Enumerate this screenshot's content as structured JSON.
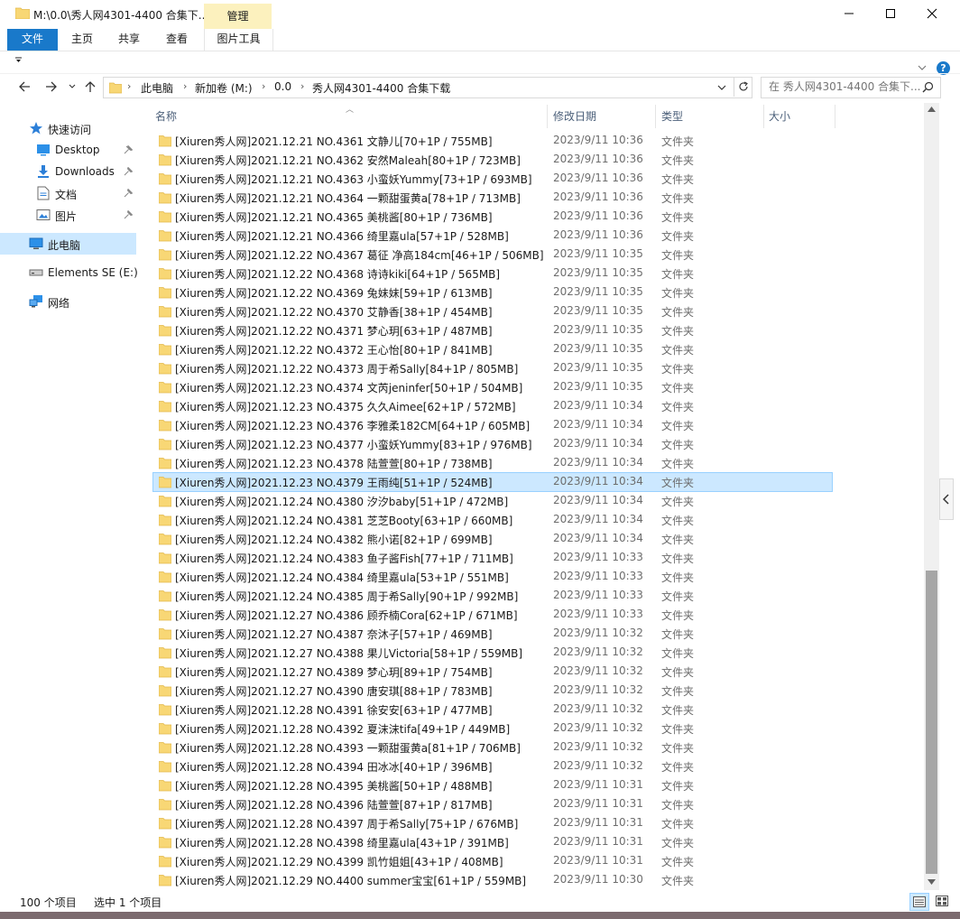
{
  "window": {
    "title": "M:\\0.0\\秀人网4301-4400 合集下...",
    "manage_tab": "管理"
  },
  "ribbon": {
    "tabs": [
      "文件",
      "主页",
      "共享",
      "查看",
      "图片工具"
    ]
  },
  "address": {
    "crumbs": [
      "此电脑",
      "新加卷 (M:)",
      "0.0",
      "秀人网4301-4400 合集下载"
    ]
  },
  "search": {
    "placeholder": "在 秀人网4301-4400 合集下..."
  },
  "nav": {
    "quick_access": "快速访问",
    "items": [
      {
        "label": "Desktop",
        "icon": "desktop-icon",
        "pinned": true
      },
      {
        "label": "Downloads",
        "icon": "downloads-icon",
        "pinned": true
      },
      {
        "label": "文档",
        "icon": "documents-icon",
        "pinned": true
      },
      {
        "label": "图片",
        "icon": "pictures-icon",
        "pinned": true
      }
    ],
    "this_pc": "此电脑",
    "drive": "Elements SE (E:)",
    "network": "网络"
  },
  "columns": {
    "name": "名称",
    "date": "修改日期",
    "type": "类型",
    "size": "大小"
  },
  "files": [
    {
      "name": "[Xiuren秀人网]2021.12.21 NO.4361 文静儿[70+1P / 755MB]",
      "date": "2023/9/11 10:36",
      "type": "文件夹"
    },
    {
      "name": "[Xiuren秀人网]2021.12.21 NO.4362 安然Maleah[80+1P / 723MB]",
      "date": "2023/9/11 10:36",
      "type": "文件夹"
    },
    {
      "name": "[Xiuren秀人网]2021.12.21 NO.4363 小蛮妖Yummy[73+1P / 693MB]",
      "date": "2023/9/11 10:36",
      "type": "文件夹"
    },
    {
      "name": "[Xiuren秀人网]2021.12.21 NO.4364 一颗甜蛋黄a[78+1P / 713MB]",
      "date": "2023/9/11 10:36",
      "type": "文件夹"
    },
    {
      "name": "[Xiuren秀人网]2021.12.21 NO.4365 美桃酱[80+1P / 736MB]",
      "date": "2023/9/11 10:36",
      "type": "文件夹"
    },
    {
      "name": "[Xiuren秀人网]2021.12.21 NO.4366 绮里嘉ula[57+1P / 528MB]",
      "date": "2023/9/11 10:36",
      "type": "文件夹"
    },
    {
      "name": "[Xiuren秀人网]2021.12.22 NO.4367 葛征 净高184cm[46+1P / 506MB]",
      "date": "2023/9/11 10:35",
      "type": "文件夹"
    },
    {
      "name": "[Xiuren秀人网]2021.12.22 NO.4368 诗诗kiki[64+1P / 565MB]",
      "date": "2023/9/11 10:35",
      "type": "文件夹"
    },
    {
      "name": "[Xiuren秀人网]2021.12.22 NO.4369 兔妹妹[59+1P / 613MB]",
      "date": "2023/9/11 10:35",
      "type": "文件夹"
    },
    {
      "name": "[Xiuren秀人网]2021.12.22 NO.4370 艾静香[38+1P / 454MB]",
      "date": "2023/9/11 10:35",
      "type": "文件夹"
    },
    {
      "name": "[Xiuren秀人网]2021.12.22 NO.4371 梦心玥[63+1P / 487MB]",
      "date": "2023/9/11 10:35",
      "type": "文件夹"
    },
    {
      "name": "[Xiuren秀人网]2021.12.22 NO.4372 王心怡[80+1P / 841MB]",
      "date": "2023/9/11 10:35",
      "type": "文件夹"
    },
    {
      "name": "[Xiuren秀人网]2021.12.22 NO.4373 周于希Sally[84+1P / 805MB]",
      "date": "2023/9/11 10:35",
      "type": "文件夹"
    },
    {
      "name": "[Xiuren秀人网]2021.12.23 NO.4374 文芮jeninfer[50+1P / 504MB]",
      "date": "2023/9/11 10:35",
      "type": "文件夹"
    },
    {
      "name": "[Xiuren秀人网]2021.12.23 NO.4375 久久Aimee[62+1P / 572MB]",
      "date": "2023/9/11 10:34",
      "type": "文件夹"
    },
    {
      "name": "[Xiuren秀人网]2021.12.23 NO.4376 李雅柔182CM[64+1P / 605MB]",
      "date": "2023/9/11 10:34",
      "type": "文件夹"
    },
    {
      "name": "[Xiuren秀人网]2021.12.23 NO.4377 小蛮妖Yummy[83+1P / 976MB]",
      "date": "2023/9/11 10:34",
      "type": "文件夹"
    },
    {
      "name": "[Xiuren秀人网]2021.12.23 NO.4378 陆萱萱[80+1P / 738MB]",
      "date": "2023/9/11 10:34",
      "type": "文件夹"
    },
    {
      "name": "[Xiuren秀人网]2021.12.23 NO.4379 王雨纯[51+1P / 524MB]",
      "date": "2023/9/11 10:34",
      "type": "文件夹",
      "selected": true
    },
    {
      "name": "[Xiuren秀人网]2021.12.24 NO.4380 汐汐baby[51+1P / 472MB]",
      "date": "2023/9/11 10:34",
      "type": "文件夹"
    },
    {
      "name": "[Xiuren秀人网]2021.12.24 NO.4381 芝芝Booty[63+1P / 660MB]",
      "date": "2023/9/11 10:34",
      "type": "文件夹"
    },
    {
      "name": "[Xiuren秀人网]2021.12.24 NO.4382 熊小诺[82+1P / 699MB]",
      "date": "2023/9/11 10:34",
      "type": "文件夹"
    },
    {
      "name": "[Xiuren秀人网]2021.12.24 NO.4383 鱼子酱Fish[77+1P / 711MB]",
      "date": "2023/9/11 10:33",
      "type": "文件夹"
    },
    {
      "name": "[Xiuren秀人网]2021.12.24 NO.4384 绮里嘉ula[53+1P / 551MB]",
      "date": "2023/9/11 10:33",
      "type": "文件夹"
    },
    {
      "name": "[Xiuren秀人网]2021.12.24 NO.4385 周于希Sally[90+1P / 992MB]",
      "date": "2023/9/11 10:33",
      "type": "文件夹"
    },
    {
      "name": "[Xiuren秀人网]2021.12.27 NO.4386 顾乔楠Cora[62+1P / 671MB]",
      "date": "2023/9/11 10:33",
      "type": "文件夹"
    },
    {
      "name": "[Xiuren秀人网]2021.12.27 NO.4387 奈沐子[57+1P / 469MB]",
      "date": "2023/9/11 10:32",
      "type": "文件夹"
    },
    {
      "name": "[Xiuren秀人网]2021.12.27 NO.4388 果儿Victoria[58+1P / 559MB]",
      "date": "2023/9/11 10:32",
      "type": "文件夹"
    },
    {
      "name": "[Xiuren秀人网]2021.12.27 NO.4389 梦心玥[89+1P / 754MB]",
      "date": "2023/9/11 10:32",
      "type": "文件夹"
    },
    {
      "name": "[Xiuren秀人网]2021.12.27 NO.4390 唐安琪[88+1P / 783MB]",
      "date": "2023/9/11 10:32",
      "type": "文件夹"
    },
    {
      "name": "[Xiuren秀人网]2021.12.28 NO.4391 徐安安[63+1P / 477MB]",
      "date": "2023/9/11 10:32",
      "type": "文件夹"
    },
    {
      "name": "[Xiuren秀人网]2021.12.28 NO.4392 夏沫沫tifa[49+1P / 449MB]",
      "date": "2023/9/11 10:32",
      "type": "文件夹"
    },
    {
      "name": "[Xiuren秀人网]2021.12.28 NO.4393 一颗甜蛋黄a[81+1P / 706MB]",
      "date": "2023/9/11 10:32",
      "type": "文件夹"
    },
    {
      "name": "[Xiuren秀人网]2021.12.28 NO.4394 田冰冰[40+1P / 396MB]",
      "date": "2023/9/11 10:32",
      "type": "文件夹"
    },
    {
      "name": "[Xiuren秀人网]2021.12.28 NO.4395 美桃酱[50+1P / 488MB]",
      "date": "2023/9/11 10:31",
      "type": "文件夹"
    },
    {
      "name": "[Xiuren秀人网]2021.12.28 NO.4396 陆萱萱[87+1P / 817MB]",
      "date": "2023/9/11 10:31",
      "type": "文件夹"
    },
    {
      "name": "[Xiuren秀人网]2021.12.28 NO.4397 周于希Sally[75+1P / 676MB]",
      "date": "2023/9/11 10:31",
      "type": "文件夹"
    },
    {
      "name": "[Xiuren秀人网]2021.12.28 NO.4398 绮里嘉ula[43+1P / 391MB]",
      "date": "2023/9/11 10:31",
      "type": "文件夹"
    },
    {
      "name": "[Xiuren秀人网]2021.12.29 NO.4399 凯竹姐姐[43+1P / 408MB]",
      "date": "2023/9/11 10:31",
      "type": "文件夹"
    },
    {
      "name": "[Xiuren秀人网]2021.12.29 NO.4400 summer宝宝[61+1P / 559MB]",
      "date": "2023/9/11 10:30",
      "type": "文件夹"
    }
  ],
  "status": {
    "count": "100 个项目",
    "selected": "选中 1 个项目"
  },
  "colors": {
    "accent": "#1979ca",
    "selection": "#cce8ff",
    "folder": "#f8d775",
    "manage_tab": "#fcf1be"
  }
}
